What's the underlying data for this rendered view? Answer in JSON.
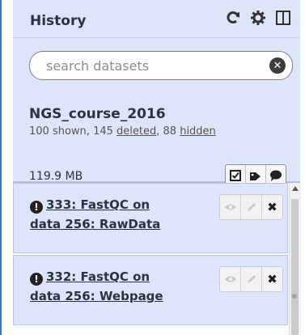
{
  "history_panel": {
    "title": "History",
    "header_icons": [
      "refresh-icon",
      "gear-icon",
      "columns-icon"
    ],
    "search": {
      "placeholder": "search datasets",
      "value": ""
    },
    "name": "NGS_course_2016",
    "counts": {
      "shown_text": "100 shown, ",
      "deleted_count": "145",
      "deleted_label": "deleted",
      "sep": ", ",
      "hidden_count": "88",
      "hidden_label": "hidden"
    },
    "size": "119.9 MB",
    "action_icons": [
      "checkbox-icon",
      "tags-icon",
      "comment-icon"
    ]
  },
  "datasets": [
    {
      "hid_title_line1": "333: FastQC on",
      "hid_title_line2": "data 256: RawData"
    },
    {
      "hid_title_line1": "332: FastQC on",
      "hid_title_line2": "data 256: Webpage"
    }
  ],
  "colors": {
    "panel_bg": "#dfe5f9",
    "accent_rule": "#2f74d0"
  }
}
